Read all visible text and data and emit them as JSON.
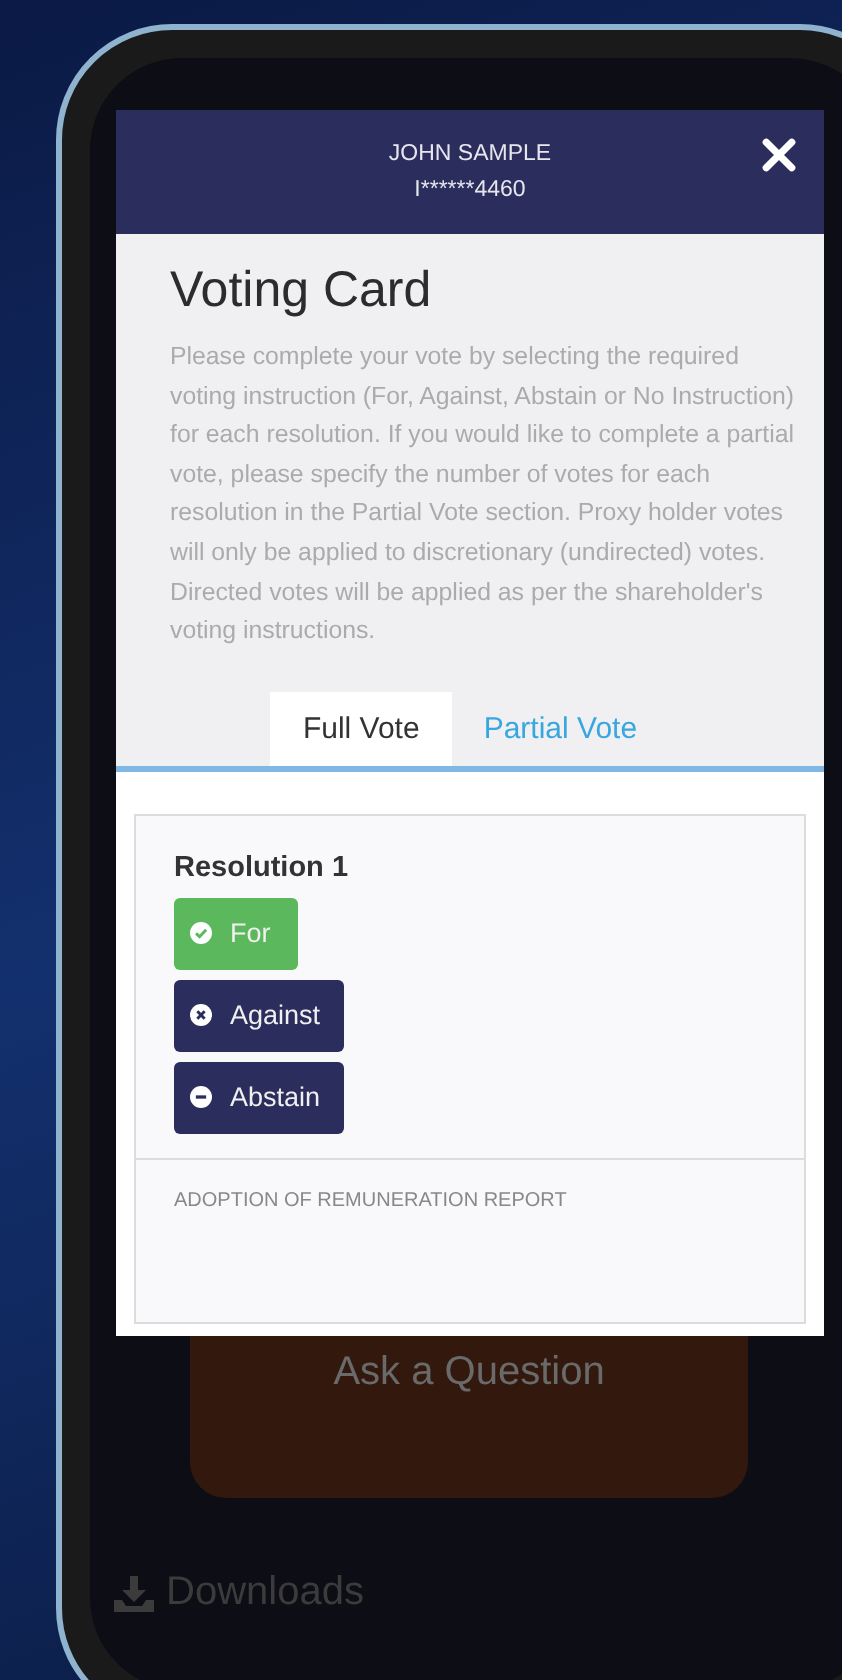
{
  "modal": {
    "holder_name": "JOHN SAMPLE",
    "holder_id": "I******4460",
    "title": "Voting Card",
    "instructions": "Please complete your vote by selecting the required voting instruction (For, Against, Abstain or No Instruction) for each resolution. If you would like to complete a partial vote, please specify the number of votes for each resolution in the Partial Vote section. Proxy holder votes will only be applied to discretionary (undirected) votes. Directed votes will be applied as per the shareholder's voting instructions.",
    "tabs": [
      {
        "label": "Full Vote",
        "selected": true
      },
      {
        "label": "Partial Vote",
        "selected": false
      }
    ],
    "resolution": {
      "title": "Resolution 1",
      "description": "ADOPTION OF REMUNERATION REPORT",
      "options": [
        {
          "label": "For",
          "kind": "for",
          "selected": true
        },
        {
          "label": "Against",
          "kind": "against",
          "selected": false
        },
        {
          "label": "Abstain",
          "kind": "abstain",
          "selected": false
        }
      ]
    }
  },
  "background": {
    "question_card": "Ask a Question",
    "downloads": "Downloads"
  }
}
